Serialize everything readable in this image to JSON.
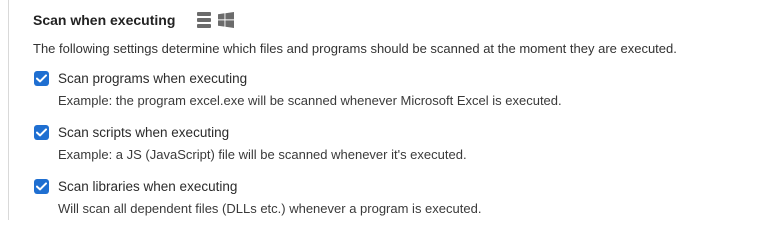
{
  "section": {
    "title": "Scan when executing",
    "icons": [
      "server-icon",
      "windows-icon"
    ],
    "description": "The following settings determine which files and programs should be scanned at the moment they are executed."
  },
  "options": [
    {
      "label": "Scan programs when executing",
      "description": "Example: the program excel.exe will be scanned whenever Microsoft Excel is executed.",
      "checked": true
    },
    {
      "label": "Scan scripts when executing",
      "description": "Example: a JS (JavaScript) file will be scanned whenever it's executed.",
      "checked": true
    },
    {
      "label": "Scan libraries when executing",
      "description": "Will scan all dependent files (DLLs etc.) whenever a program is executed.",
      "checked": true
    }
  ],
  "colors": {
    "checkbox": "#1f6fd1",
    "icon": "#6b6b6b"
  }
}
